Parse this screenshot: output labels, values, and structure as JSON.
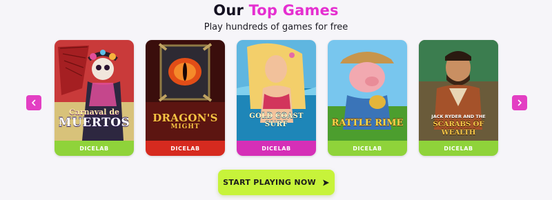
{
  "header": {
    "title_prefix": "Our ",
    "title_accent": "Top Games",
    "subtitle": "Play hundreds of games for free"
  },
  "carousel": {
    "prev_icon": "chevron-left-icon",
    "next_icon": "chevron-right-icon",
    "cards": [
      {
        "title_line1": "Carnaval de",
        "title_line2": "MUERTOS",
        "provider": "DICELAB",
        "bar_color": "#8fd33a"
      },
      {
        "title_line1": "DRAGON'S",
        "title_line2": "MIGHT",
        "provider": "DICELAB",
        "bar_color": "#d62a1f"
      },
      {
        "title_line1": "GOLD COAST",
        "title_line2": "SURF",
        "provider": "DICELAB",
        "bar_color": "#d52fb7"
      },
      {
        "title_line1": "RATTLE RIME",
        "title_line2": "",
        "provider": "DICELAB",
        "bar_color": "#8fd33a"
      },
      {
        "title_line1": "JACK RYDER AND THE",
        "title_line2": "SCARABS OF WEALTH",
        "provider": "DICELAB",
        "bar_color": "#8fd33a"
      }
    ]
  },
  "cta": {
    "label": "START PLAYING NOW",
    "icon": "play-arrow-icon"
  }
}
